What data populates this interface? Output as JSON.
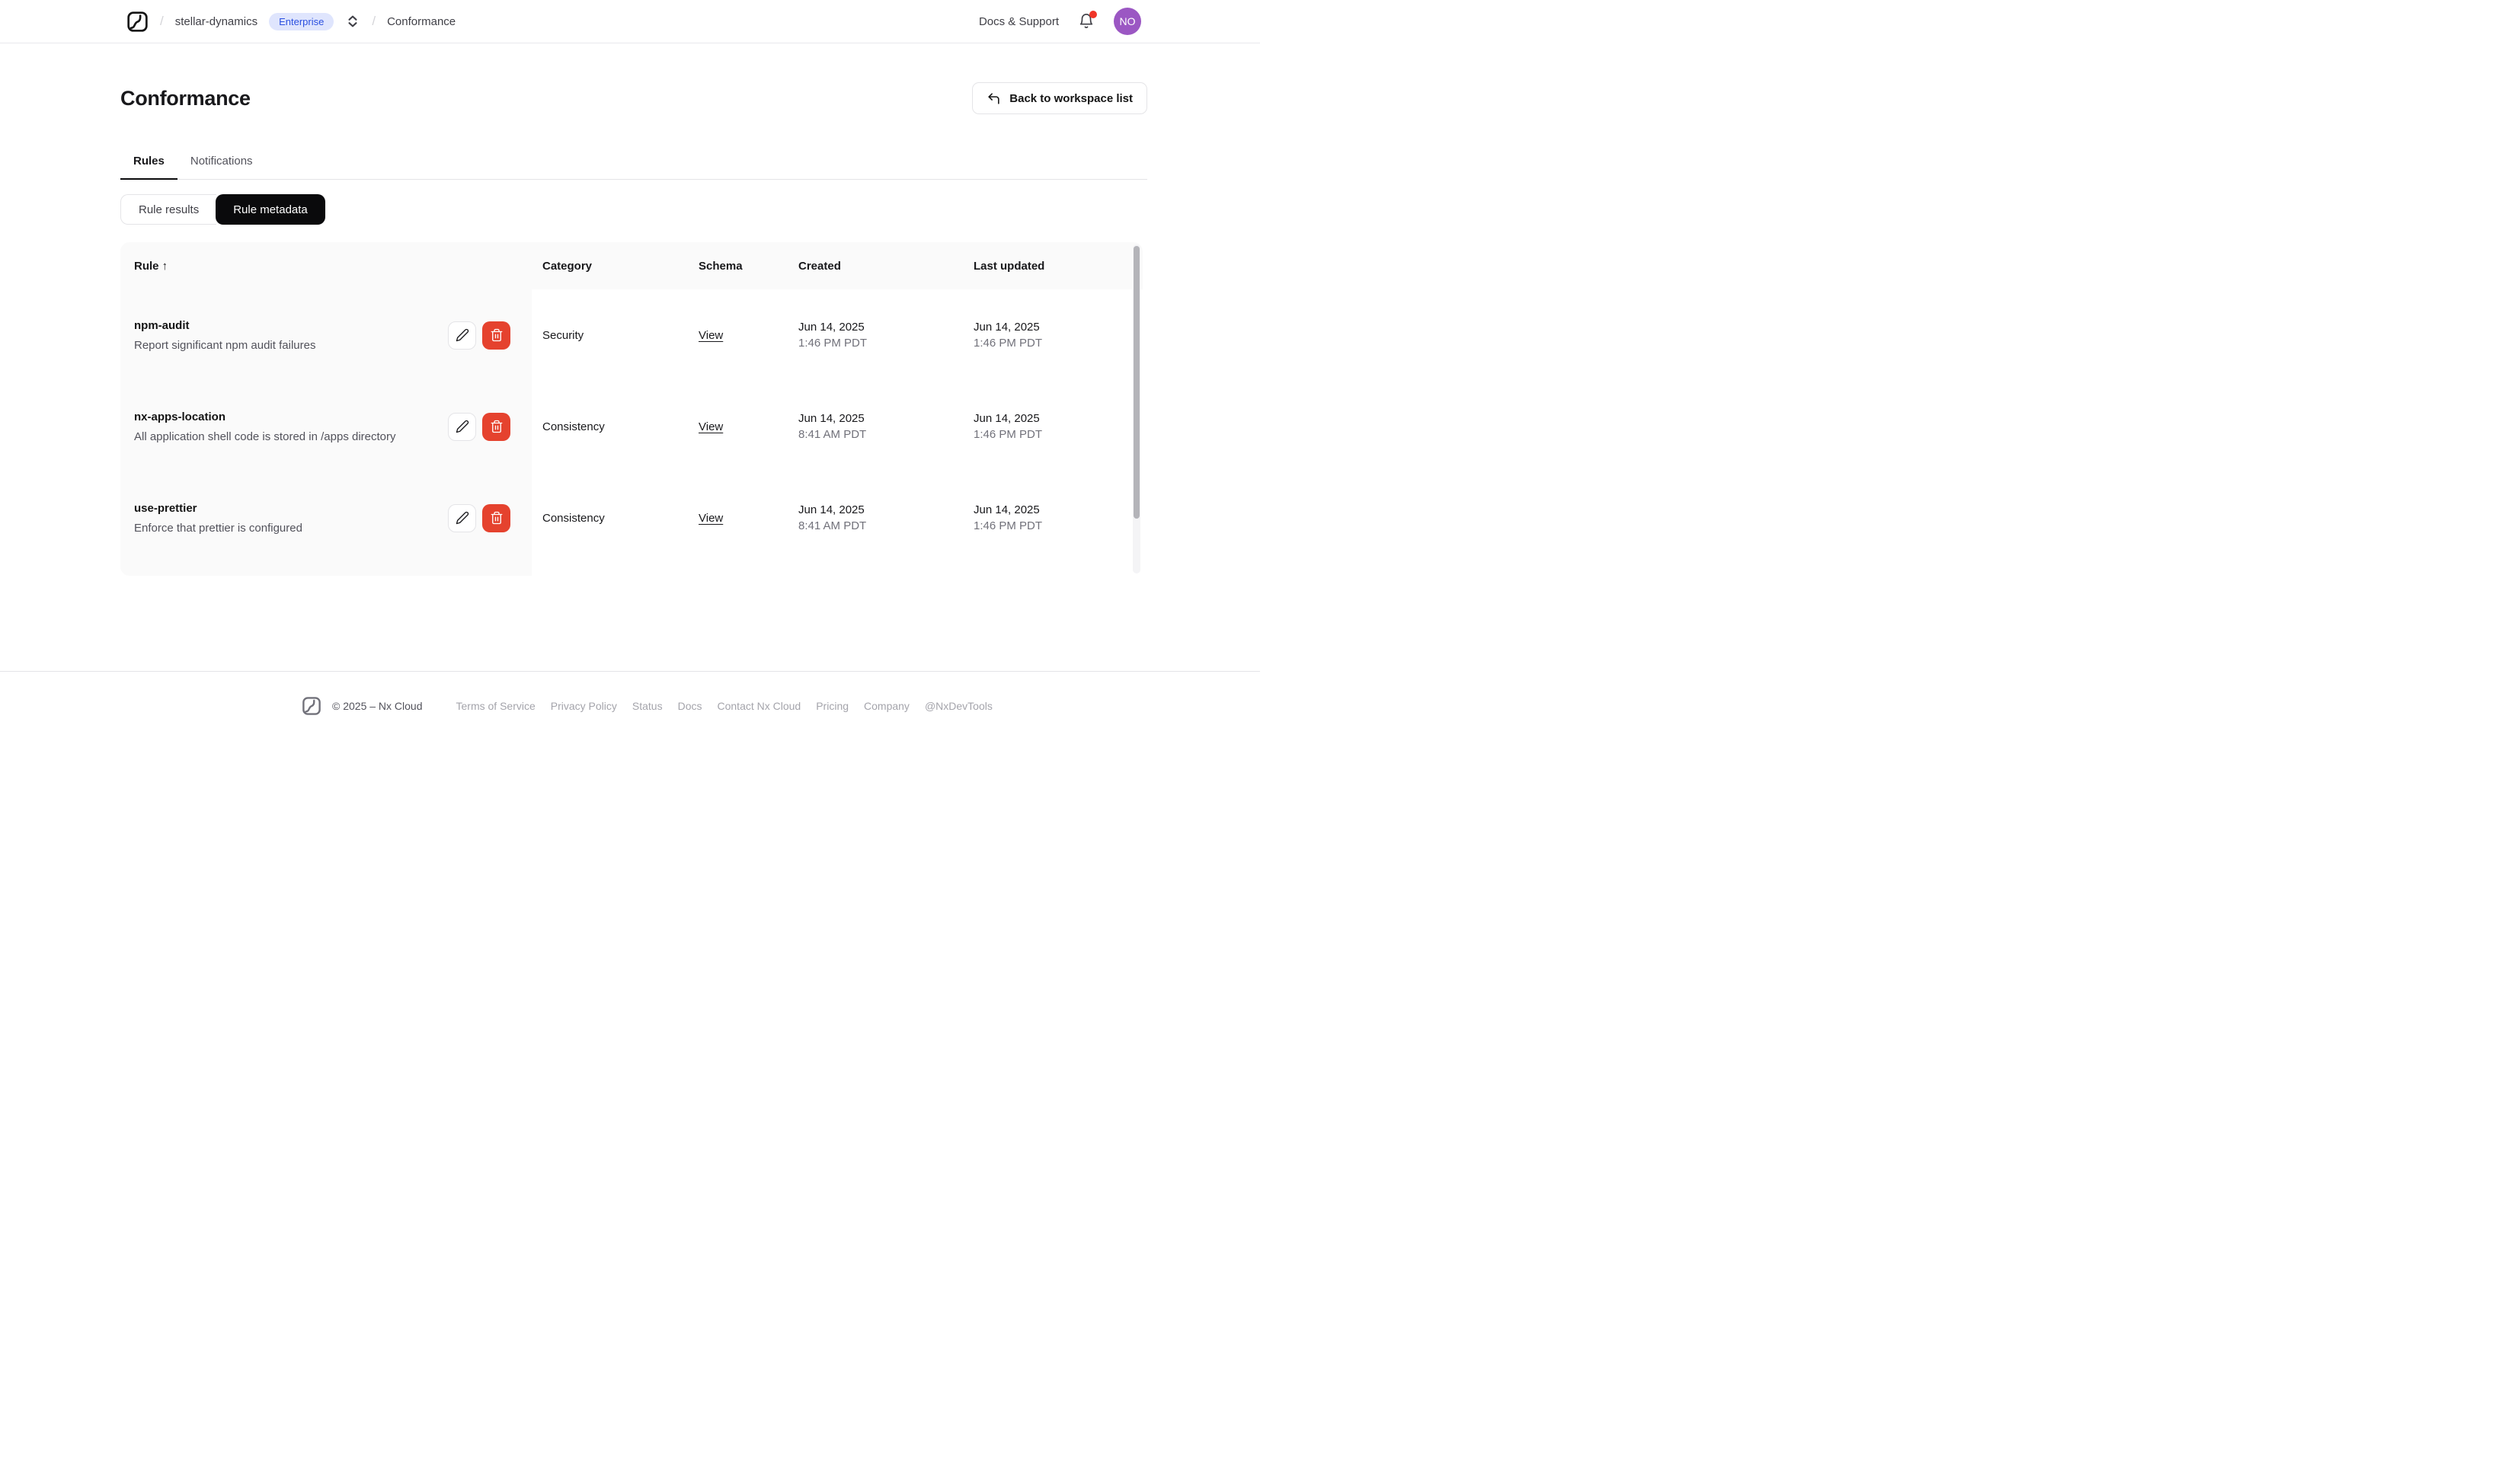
{
  "nav": {
    "breadcrumb": {
      "separator": "/",
      "workspace": "stellar-dynamics",
      "plan_badge": "Enterprise",
      "page": "Conformance"
    },
    "docs_support": "Docs & Support",
    "avatar_initials": "NO"
  },
  "page": {
    "title": "Conformance",
    "back_button_label": "Back to workspace list"
  },
  "tabs": [
    {
      "label": "Rules",
      "active": true
    },
    {
      "label": "Notifications",
      "active": false
    }
  ],
  "segmented": [
    {
      "label": "Rule results",
      "active": false
    },
    {
      "label": "Rule metadata",
      "active": true
    }
  ],
  "table": {
    "columns": [
      "Rule",
      "Category",
      "Schema",
      "Created",
      "Last updated"
    ],
    "sort_column": "Rule",
    "sort_indicator": "↑",
    "rows": [
      {
        "name": "npm-audit",
        "description": "Report significant npm audit failures",
        "category": "Security",
        "schema_link": "View",
        "created_date": "Jun 14, 2025",
        "created_time": "1:46 PM PDT",
        "updated_date": "Jun 14, 2025",
        "updated_time": "1:46 PM PDT"
      },
      {
        "name": "nx-apps-location",
        "description": "All application shell code is stored in /apps directory",
        "category": "Consistency",
        "schema_link": "View",
        "created_date": "Jun 14, 2025",
        "created_time": "8:41 AM PDT",
        "updated_date": "Jun 14, 2025",
        "updated_time": "1:46 PM PDT"
      },
      {
        "name": "use-prettier",
        "description": "Enforce that prettier is configured",
        "category": "Consistency",
        "schema_link": "View",
        "created_date": "Jun 14, 2025",
        "created_time": "8:41 AM PDT",
        "updated_date": "Jun 14, 2025",
        "updated_time": "1:46 PM PDT"
      }
    ]
  },
  "footer": {
    "copyright": "© 2025 – Nx Cloud",
    "links": [
      "Terms of Service",
      "Privacy Policy",
      "Status",
      "Docs",
      "Contact Nx Cloud",
      "Pricing",
      "Company",
      "@NxDevTools"
    ]
  },
  "colors": {
    "badge_bg": "#dfe5fd",
    "badge_text": "#2b50e0",
    "delete_red": "#e5422e",
    "avatar_purple": "#9b57c3",
    "notification_dot": "#f03528",
    "active_segment_bg": "#0a0a0c"
  },
  "icons": {
    "logo": "nx-logo",
    "switcher": "chevrons-up-down",
    "bell": "bell",
    "back": "corner-up-left",
    "edit": "pencil",
    "delete": "trash"
  }
}
